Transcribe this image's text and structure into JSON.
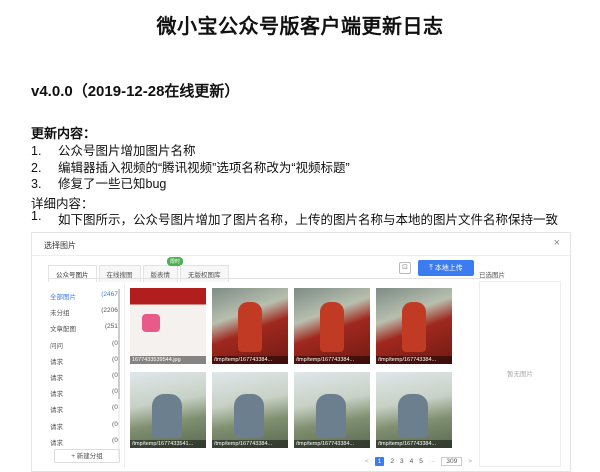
{
  "doc": {
    "title": "微小宝公众号版客户端更新日志",
    "version": "v4.0.0（2019-12-28在线更新）",
    "updates_heading": "更新内容：",
    "updates": [
      {
        "num": "1.",
        "text": "公众号图片增加图片名称"
      },
      {
        "num": "2.",
        "text": "编辑器插入视频的“腾讯视频”选项名称改为“视频标题”"
      },
      {
        "num": "3.",
        "text": "修复了一些已知bug"
      }
    ],
    "details_heading": "详细内容：",
    "details": [
      {
        "num": "1.",
        "text": "如下图所示，公众号图片增加了图片名称，上传的图片名称与本地的图片文件名称保持一致"
      }
    ]
  },
  "dialog": {
    "title": "选择图片",
    "close": "×",
    "tabs": [
      {
        "label": "公众号图片",
        "active": true
      },
      {
        "label": "在线搜图",
        "active": false
      },
      {
        "label": "版表情",
        "active": false,
        "badge": "限时"
      },
      {
        "label": "无版权图库",
        "active": false
      }
    ],
    "crop_icon": "⊡",
    "upload_icon": "⤒",
    "upload_label": "本地上传",
    "selected_label": "已选图片",
    "empty_label": "暂无图片",
    "groups": [
      {
        "name": "全部图片",
        "count": "(2467)",
        "active": true
      },
      {
        "name": "未分组",
        "count": "(2206)"
      },
      {
        "name": "文章配图",
        "count": "(251)"
      },
      {
        "name": "问问",
        "count": "(0)"
      },
      {
        "name": "请求",
        "count": "(0)"
      },
      {
        "name": "请求",
        "count": "(0)"
      },
      {
        "name": "请求",
        "count": "(0)"
      },
      {
        "name": "请求",
        "count": "(0)"
      },
      {
        "name": "请求",
        "count": "(0)"
      },
      {
        "name": "请求",
        "count": "(0)"
      }
    ],
    "new_group_label": "+ 新建分组",
    "images": [
      {
        "caption": "1677433539544.jpg",
        "kind": "app"
      },
      {
        "caption": "/tmp/temp/167743384...",
        "kind": "red"
      },
      {
        "caption": "/tmp/temp/167743384...",
        "kind": "red"
      },
      {
        "caption": "/tmp/temp/167743384...",
        "kind": "red"
      },
      {
        "caption": "/tmp/temp/1677433541...",
        "kind": "outdoor"
      },
      {
        "caption": "/tmp/temp/167743384...",
        "kind": "outdoor"
      },
      {
        "caption": "/tmp/temp/167743384...",
        "kind": "outdoor"
      },
      {
        "caption": "/tmp/temp/167743384...",
        "kind": "outdoor"
      }
    ],
    "pager": {
      "prev": "<",
      "pages": [
        "1",
        "2",
        "3",
        "4",
        "5"
      ],
      "current": "1",
      "ellipsis": "···",
      "last": "309",
      "next": ">"
    }
  }
}
